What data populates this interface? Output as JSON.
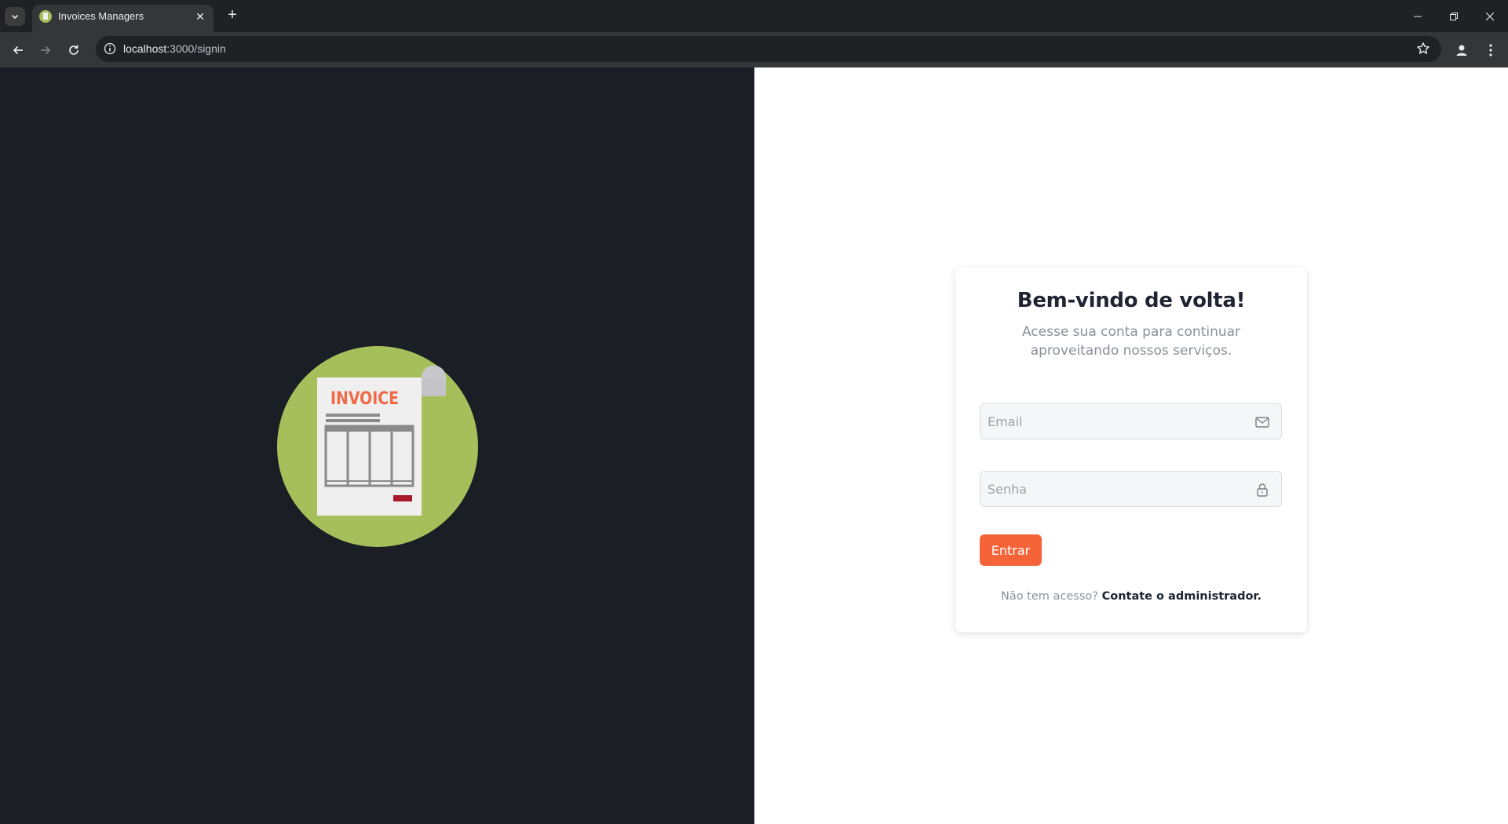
{
  "browser": {
    "tab_title": "Invoices Managers",
    "url_host": "localhost",
    "url_rest": ":3000/signin"
  },
  "illustration": {
    "label": "INVOICE",
    "circle_color": "#a6bf5b",
    "accent_color": "#f06a45"
  },
  "login": {
    "title": "Bem-vindo de volta!",
    "subtitle": "Acesse sua conta para continuar aproveitando nossos serviços.",
    "email_placeholder": "Email",
    "password_placeholder": "Senha",
    "submit_label": "Entrar",
    "footer_prompt": "Não tem acesso?",
    "footer_link": "Contate o administrador."
  },
  "colors": {
    "left_bg": "#1b1e25",
    "button": "#f56438"
  }
}
